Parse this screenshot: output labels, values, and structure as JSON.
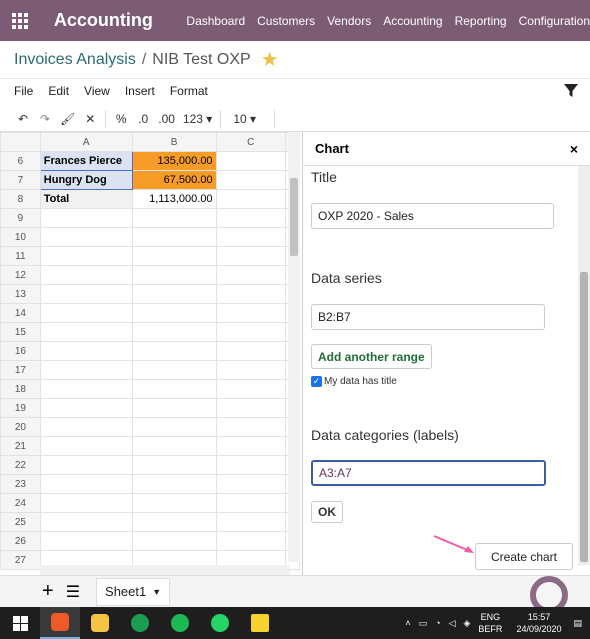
{
  "navbar": {
    "app_name": "Accounting",
    "menu": [
      "Dashboard",
      "Customers",
      "Vendors",
      "Accounting",
      "Reporting",
      "Configuration"
    ]
  },
  "breadcrumb": {
    "parent": "Invoices Analysis",
    "separator": "/",
    "current": "NIB Test OXP"
  },
  "menubar": [
    "File",
    "Edit",
    "View",
    "Insert",
    "Format"
  ],
  "toolbar": {
    "percent": "%",
    "dec_less": ".0",
    "dec_more": ".00",
    "format": "123",
    "font_size": "10"
  },
  "grid": {
    "columns": [
      "A",
      "B",
      "C"
    ],
    "rows": [
      {
        "num": "6",
        "a": "Frances Pierce",
        "b": "135,000.00"
      },
      {
        "num": "7",
        "a": "Hungry Dog",
        "b": "67,500.00"
      },
      {
        "num": "8",
        "a": "Total",
        "b": "1,113,000.00"
      },
      {
        "num": "9",
        "a": "",
        "b": ""
      },
      {
        "num": "10",
        "a": "",
        "b": ""
      },
      {
        "num": "11",
        "a": "",
        "b": ""
      },
      {
        "num": "12",
        "a": "",
        "b": ""
      },
      {
        "num": "13",
        "a": "",
        "b": ""
      },
      {
        "num": "14",
        "a": "",
        "b": ""
      },
      {
        "num": "15",
        "a": "",
        "b": ""
      },
      {
        "num": "16",
        "a": "",
        "b": ""
      },
      {
        "num": "17",
        "a": "",
        "b": ""
      },
      {
        "num": "18",
        "a": "",
        "b": ""
      },
      {
        "num": "19",
        "a": "",
        "b": ""
      },
      {
        "num": "20",
        "a": "",
        "b": ""
      },
      {
        "num": "21",
        "a": "",
        "b": ""
      },
      {
        "num": "22",
        "a": "",
        "b": ""
      },
      {
        "num": "23",
        "a": "",
        "b": ""
      },
      {
        "num": "24",
        "a": "",
        "b": ""
      },
      {
        "num": "25",
        "a": "",
        "b": ""
      },
      {
        "num": "26",
        "a": "",
        "b": ""
      },
      {
        "num": "27",
        "a": "",
        "b": ""
      }
    ]
  },
  "chart_panel": {
    "header": "Chart",
    "close": "×",
    "title_label": "Title",
    "title_value": "OXP 2020 - Sales",
    "series_label": "Data series",
    "series_value": "B2:B7",
    "add_range": "Add another range",
    "has_title": "My data has title",
    "categories_label": "Data categories (labels)",
    "categories_value": "A3:A7",
    "ok": "OK",
    "create": "Create chart"
  },
  "sheetbar": {
    "tab": "Sheet1"
  },
  "taskbar": {
    "lang1": "ENG",
    "lang2": "BEFR",
    "time": "15:57",
    "date": "24/09/2020"
  },
  "colors": {
    "navbar": "#7c5b74",
    "highlight": "#f99b27",
    "link": "#2b6a77",
    "button_text": "#1f6e3a"
  }
}
